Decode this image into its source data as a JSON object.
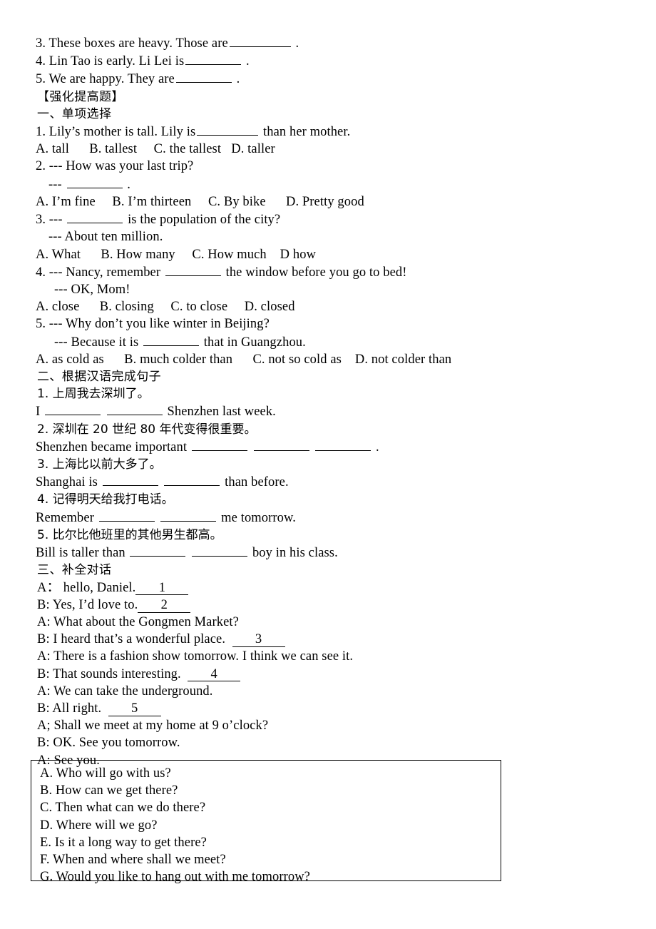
{
  "document": {
    "top_fill_in_items": [
      "3. These boxes are heavy. Those are",
      "4. Lin Tao is early. Li Lei is",
      "5. We are happy. They are"
    ],
    "top_fill_in_tail": ".",
    "enhancement_heading": "【强化提高题】",
    "section_one": {
      "heading": "一、单项选择",
      "q1": {
        "stem_before": "1. Lily’s mother is tall. Lily is",
        "stem_after": "than her mother.",
        "options": "A. tall      B. tallest     C. the tallest   D. taller"
      },
      "q2": {
        "stem": "2. --- How was your last trip?",
        "answer_line_prefix": "---",
        "answer_line_suffix": ".",
        "options": "A. I’m fine     B. I’m thirteen     C. By bike      D. Pretty good"
      },
      "q3": {
        "stem_before": "3. ---",
        "stem_after": "is the population of the city?",
        "reply": "--- About ten million.",
        "options": "A. What      B. How many     C. How much    D how"
      },
      "q4": {
        "stem_before": "4. --- Nancy, remember",
        "stem_after": "the window before you go to bed!",
        "reply": "--- OK, Mom!",
        "options": "A. close      B. closing     C. to close     D. closed"
      },
      "q5": {
        "stem": "5. --- Why don’t you like winter in Beijing?",
        "reply_before": "--- Because it is",
        "reply_after": "that in Guangzhou.",
        "options": "A. as cold as      B. much colder than      C. not so cold as    D. not colder than"
      }
    },
    "section_two": {
      "heading": "二、根据汉语完成句子",
      "items": [
        {
          "chinese": "1. 上周我去深圳了。",
          "english_before": "I",
          "english_after": "Shenzhen last week.",
          "blanks": 2
        },
        {
          "chinese": "2. 深圳在 20 世纪 80 年代变得很重要。",
          "english_before": "Shenzhen became important",
          "english_after": ".",
          "blanks": 3
        },
        {
          "chinese": "3. 上海比以前大多了。",
          "english_before": "Shanghai is",
          "english_after": "than before.",
          "blanks": 2
        },
        {
          "chinese": "4. 记得明天给我打电话。",
          "english_before": "Remember",
          "english_after": "me tomorrow.",
          "blanks": 2
        },
        {
          "chinese": "5. 比尔比他班里的其他男生都高。",
          "english_before": "Bill is taller than",
          "english_after": "boy in his class.",
          "blanks": 2
        }
      ]
    },
    "section_three": {
      "heading": "三、补全对话",
      "dialogue": [
        {
          "speaker": "A：",
          "text": "hello, Daniel.",
          "blank_number": "1"
        },
        {
          "speaker": "B:",
          "text": "Yes, I’d love to.",
          "blank_number": "2"
        },
        {
          "speaker": "A:",
          "text": "What about the Gongmen Market?",
          "blank_number": ""
        },
        {
          "speaker": "B:",
          "text": "I heard that’s a wonderful place.",
          "blank_number": "3"
        },
        {
          "speaker": "A:",
          "text": "There is a fashion show tomorrow. I think we can see it.",
          "blank_number": ""
        },
        {
          "speaker": "B:",
          "text": "That sounds interesting.",
          "blank_number": "4"
        },
        {
          "speaker": "A:",
          "text": "We can take the underground.",
          "blank_number": ""
        },
        {
          "speaker": "B:",
          "text": "All right.",
          "blank_number": "5"
        },
        {
          "speaker": "A;",
          "text": "Shall we meet at my home at 9 o’clock?",
          "blank_number": ""
        },
        {
          "speaker": "B:",
          "text": "OK. See you tomorrow.",
          "blank_number": ""
        },
        {
          "speaker": "A:",
          "text": "See you.",
          "blank_number": ""
        }
      ],
      "options_box": [
        "A. Who will go with us?",
        "B. How can we get there?",
        "C. Then what can we do there?",
        "D. Where will we go?",
        "E. Is it a long way to get there?",
        "F. When and where shall we meet?",
        "G. Would you like to hang out with me tomorrow?"
      ]
    }
  }
}
